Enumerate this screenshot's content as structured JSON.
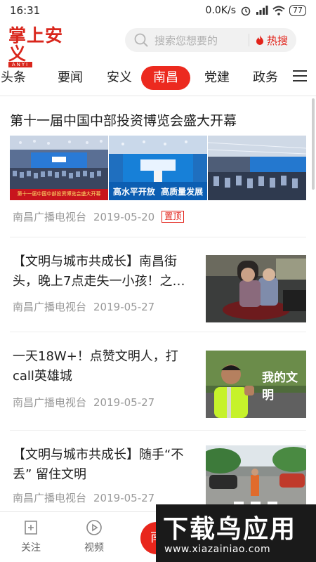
{
  "status_bar": {
    "time": "16:31",
    "network_speed": "0.0K/s",
    "battery": "77"
  },
  "header": {
    "logo": "掌上安义",
    "logo_sub": "ANYI",
    "search_placeholder": "搜索您想要的",
    "hot_label": "热搜"
  },
  "tabs": [
    {
      "label": "头条",
      "active": false
    },
    {
      "label": "要闻",
      "active": false
    },
    {
      "label": "安义",
      "active": false
    },
    {
      "label": "南昌",
      "active": true
    },
    {
      "label": "党建",
      "active": false
    },
    {
      "label": "政务",
      "active": false
    }
  ],
  "feed": {
    "featured": {
      "title": "第十一届中国中部投资博览会盛大开幕",
      "image_caption": "第十一届中国中部投资博览会盛大开幕",
      "stage_text": "高水平开放  高质量发展",
      "source": "南昌广播电视台",
      "date": "2019-05-20",
      "badge": "置顶"
    },
    "items": [
      {
        "title": "【文明与城市共成长】南昌街头，晚上7点走失一小孩！之…",
        "source": "南昌广播电视台",
        "date": "2019-05-27",
        "image_text": ""
      },
      {
        "title": "一天18W+！点赞文明人，打call英雄城",
        "source": "南昌广播电视台",
        "date": "2019-05-27",
        "image_text": "我的文明"
      },
      {
        "title": "【文明与城市共成长】随手“不丢” 留住文明",
        "source": "南昌广播电视台",
        "date": "2019-05-27",
        "image_text": ""
      }
    ]
  },
  "bottom_nav": {
    "follow": "关注",
    "video": "视频",
    "center": "南"
  },
  "watermark": {
    "title": "下载鸟应用",
    "url": "www.xiazainiao.com"
  },
  "colors": {
    "accent": "#ec2a1f",
    "text_gray": "#999999"
  }
}
